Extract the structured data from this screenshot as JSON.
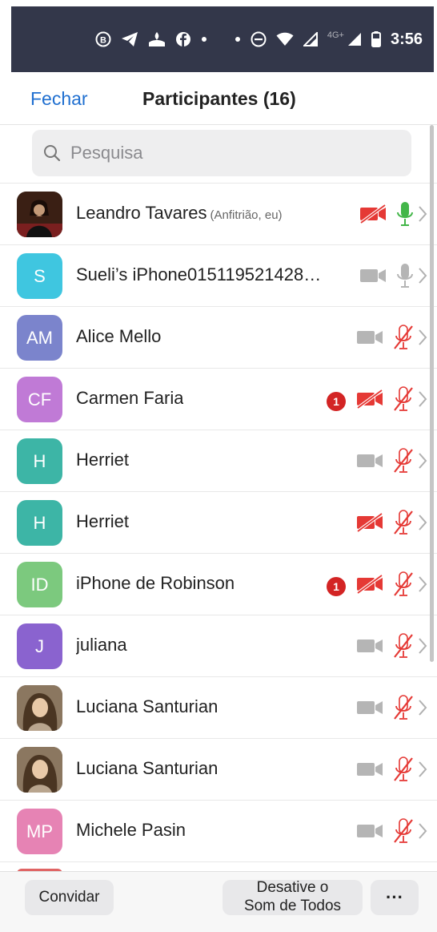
{
  "status_bar": {
    "time": "3:56",
    "network_label": "4G+",
    "icons": [
      "b-circle-icon",
      "telegram-icon",
      "santander-icon",
      "facebook-icon",
      "dot-icon",
      "dot-icon",
      "do-not-disturb-icon",
      "wifi-icon",
      "signal-icon",
      "signal-icon",
      "battery-icon"
    ]
  },
  "header": {
    "close_label": "Fechar",
    "title": "Participantes (16)"
  },
  "search": {
    "placeholder": "Pesquisa",
    "value": ""
  },
  "participants": [
    {
      "name": "Leandro Tavares",
      "role": "(Anfitrião, eu)",
      "avatar": "",
      "avatar_color": "#5a3a2a",
      "photo": true,
      "video": "off",
      "mic": "on",
      "badge": ""
    },
    {
      "name": "Sueli’s iPhone015119521428…",
      "role": "",
      "avatar": "S",
      "avatar_color": "#3fc6e0",
      "photo": false,
      "video": "inactive",
      "mic": "inactive",
      "badge": ""
    },
    {
      "name": "Alice Mello",
      "role": "",
      "avatar": "AM",
      "avatar_color": "#7b84cc",
      "photo": false,
      "video": "inactive",
      "mic": "muted",
      "badge": ""
    },
    {
      "name": "Carmen Faria",
      "role": "",
      "avatar": "CF",
      "avatar_color": "#c07ad6",
      "photo": false,
      "video": "off",
      "mic": "muted",
      "badge": "1"
    },
    {
      "name": "Herriet",
      "role": "",
      "avatar": "H",
      "avatar_color": "#3db5a6",
      "photo": false,
      "video": "inactive",
      "mic": "muted",
      "badge": ""
    },
    {
      "name": "Herriet",
      "role": "",
      "avatar": "H",
      "avatar_color": "#3db5a6",
      "photo": false,
      "video": "off",
      "mic": "muted",
      "badge": ""
    },
    {
      "name": "iPhone de Robinson",
      "role": "",
      "avatar": "ID",
      "avatar_color": "#7cc97e",
      "photo": false,
      "video": "off",
      "mic": "muted",
      "badge": "1"
    },
    {
      "name": "juliana",
      "role": "",
      "avatar": "J",
      "avatar_color": "#8a63cf",
      "photo": false,
      "video": "inactive",
      "mic": "muted",
      "badge": ""
    },
    {
      "name": "Luciana Santurian",
      "role": "",
      "avatar": "",
      "avatar_color": "#6b5a4a",
      "photo": true,
      "video": "inactive",
      "mic": "muted",
      "badge": ""
    },
    {
      "name": "Luciana Santurian",
      "role": "",
      "avatar": "",
      "avatar_color": "#6b5a4a",
      "photo": true,
      "video": "inactive",
      "mic": "muted",
      "badge": ""
    },
    {
      "name": "Michele Pasin",
      "role": "",
      "avatar": "MP",
      "avatar_color": "#e683b4",
      "photo": false,
      "video": "inactive",
      "mic": "muted",
      "badge": ""
    }
  ],
  "bottom_bar": {
    "invite_label": "Convidar",
    "mute_all_line1": "Desative o",
    "mute_all_line2": "Som de Todos",
    "more_label": "···"
  },
  "colors": {
    "accent": "#1f6fd0",
    "muted_red": "#e53935",
    "mic_on_green": "#43b649",
    "inactive_gray": "#b5b5b5",
    "status_bar": "#33374a"
  }
}
